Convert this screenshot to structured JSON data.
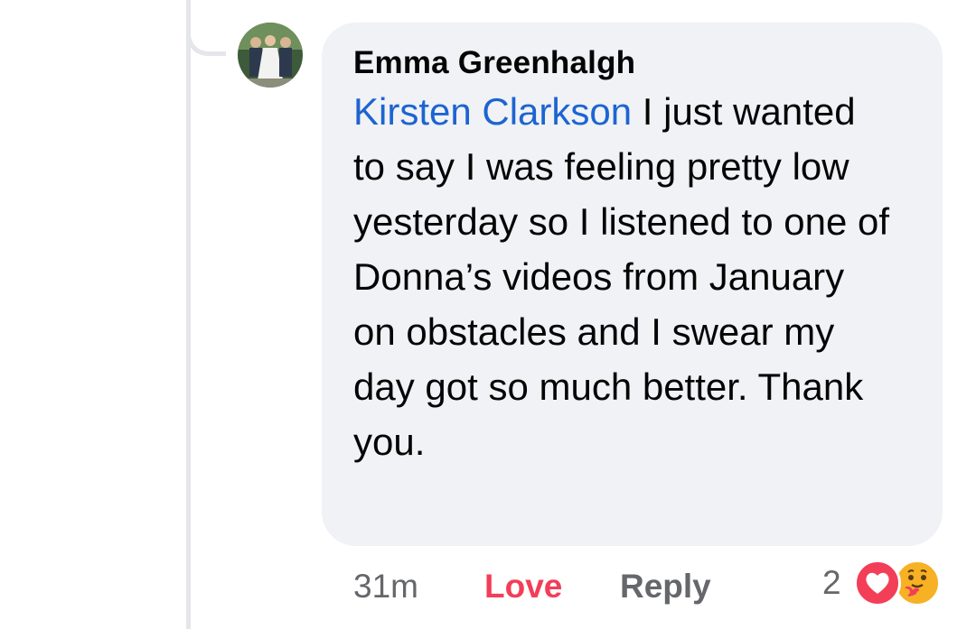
{
  "comment": {
    "author": "Emma Greenhalgh",
    "mention": "Kirsten Clarkson",
    "text": " I just wanted to say I was feeling pretty low yesterday so I listened to one of Donna’s videos from January on obstacles and I swear my day got so much better. Thank you.",
    "timestamp": "31m",
    "love_label": "Love",
    "reply_label": "Reply",
    "reaction_count": "2",
    "reactions": [
      "love-icon",
      "care-icon"
    ]
  },
  "colors": {
    "mention": "#1d64d1",
    "love": "#f33e58",
    "meta": "#65676b",
    "bubble": "#f0f2f5",
    "thread": "#e4e6eb"
  }
}
